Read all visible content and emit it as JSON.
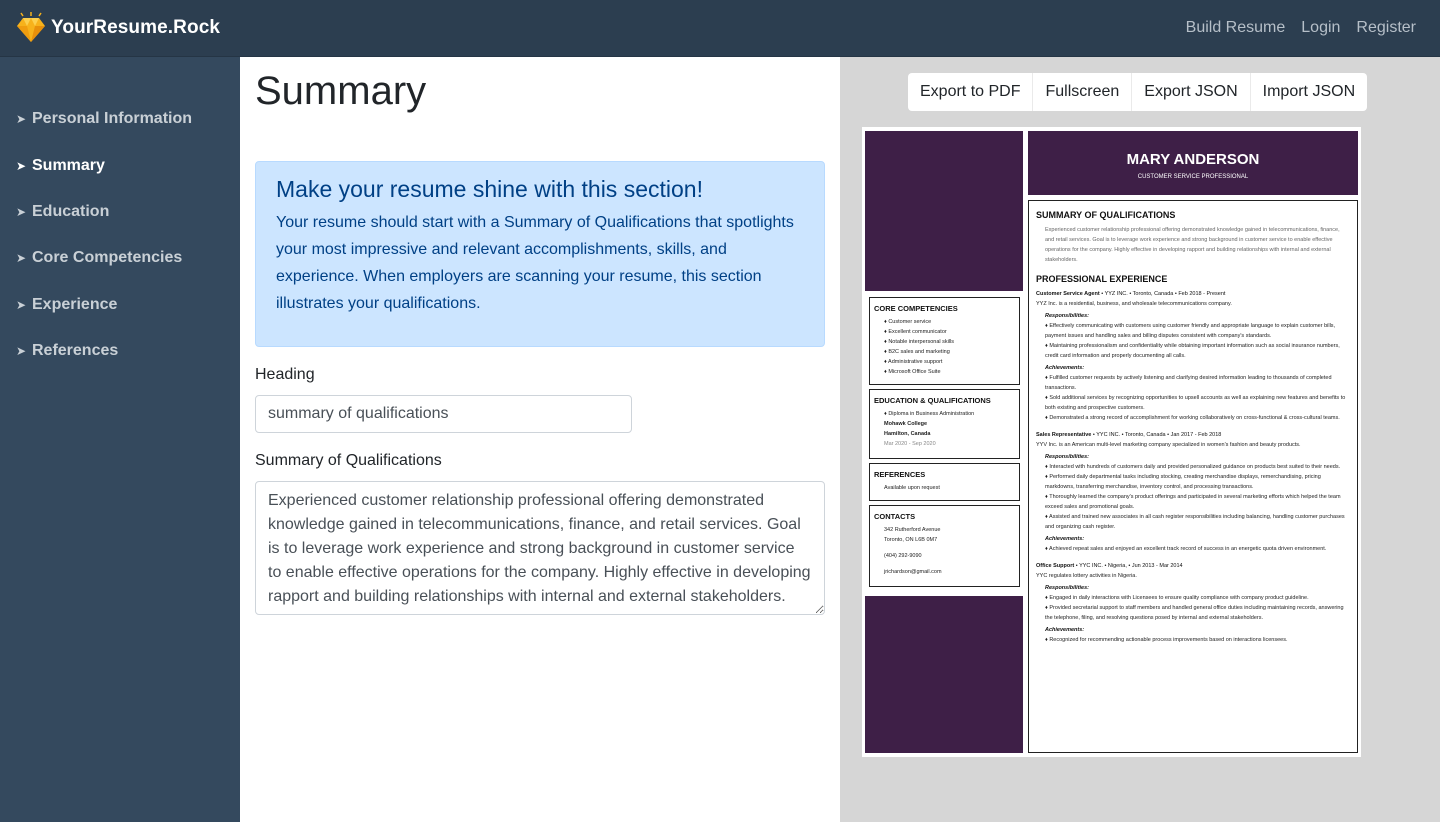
{
  "brand": {
    "name": "YourResume.Rock",
    "icon": "diamond-icon"
  },
  "nav": [
    "Build Resume",
    "Login",
    "Register"
  ],
  "sidebar": {
    "items": [
      {
        "label": "Personal Information"
      },
      {
        "label": "Summary"
      },
      {
        "label": "Education"
      },
      {
        "label": "Core Competencies"
      },
      {
        "label": "Experience"
      },
      {
        "label": "References"
      }
    ],
    "active": "Summary"
  },
  "editor": {
    "title": "Summary",
    "alert": {
      "title": "Make your resume shine with this section!",
      "text": "Your resume should start with a Summary of Qualifications that spotlights your most impressive and relevant accomplishments, skills, and experience. When employers are scanning your resume, this section illustrates your qualifications."
    },
    "heading_label": "Heading",
    "heading_value": "summary of qualifications",
    "summary_label": "Summary of Qualifications",
    "summary_value": "Experienced customer relationship professional offering demonstrated knowledge gained in telecommunications, finance, and retail services. Goal is to leverage work experience and strong background in customer service to enable effective operations for the company. Highly effective in developing rapport and building relationships with internal and external stakeholders."
  },
  "toolbar": {
    "export_pdf": "Export to PDF",
    "fullscreen": "Fullscreen",
    "export_json": "Export JSON",
    "import_json": "Import JSON"
  },
  "resume": {
    "accent_color": "#3e1f47",
    "name": "MARY ANDERSON",
    "role": "CUSTOMER SERVICE PROFESSIONAL",
    "core": {
      "title": "CORE COMPETENCIES",
      "items": [
        "♦ Customer service",
        "♦ Excellent communicator",
        "♦ Notable interpersonal skills",
        "♦ B2C sales and marketing",
        "♦ Administrative support",
        "♦ Microsoft Office Suite"
      ]
    },
    "education": {
      "title": "EDUCATION & QUALIFICATIONS",
      "degree": "♦ Diploma in Business Administration",
      "school": "Mohawk College",
      "location": "Hamilton, Canada",
      "dates": "Mar 2020 - Sep 2020"
    },
    "references": {
      "title": "REFERENCES",
      "text": "Available upon request"
    },
    "contacts": {
      "title": "CONTACTS",
      "address1": "342 Rutherford Avenue",
      "address2": "Toronto, ON L6B 0M7",
      "phone": "(404) 292-9090",
      "email": "jrichardson@gmail.com"
    },
    "summary": {
      "title": "SUMMARY OF QUALIFICATIONS",
      "text": "Experienced customer relationship professional offering demonstrated knowledge gained in telecommunications, finance, and retail services. Goal is to leverage work experience and strong background in customer service to enable effective operations for the company. Highly effective in developing rapport and building relationships with internal and external stakeholders."
    },
    "experience_title": "PROFESSIONAL EXPERIENCE",
    "responsibilities_label": "Responsibilities:",
    "achievements_label": "Achievements:",
    "jobs": [
      {
        "title": "Customer Service Agent",
        "meta": " • YYZ INC. •  Toronto, Canada • Feb 2018 - Present",
        "desc": "YYZ Inc. is a residential, business, and wholesale telecommunications company.",
        "resp": [
          "♦ Effectively communicating with customers using customer friendly and appropriate language to explain customer bills, payment issues and handling sales and billing disputes consistent with company's standards.",
          "♦ Maintaining professionalism and confidentiality while obtaining important information such as social insurance numbers, credit card information and properly documenting all calls."
        ],
        "ach": [
          "♦ Fulfilled customer requests by actively listening and clarifying desired information leading to thousands of completed transactions.",
          "♦ Sold additional services by recognizing opportunities to upsell accounts as well as explaining new features and benefits to both existing and prospective customers.",
          "♦ Demonstrated a strong record of accomplishment for working collaboratively on cross-functional & cross-cultural teams."
        ]
      },
      {
        "title": "Sales Representative",
        "meta": " • YYC INC. •  Toronto, Canada • Jan 2017 - Feb 2018",
        "desc": "YYV Inc. is an American multi-level marketing company specialized in women's fashion and beauty products.",
        "resp": [
          "♦ Interacted with hundreds of customers daily and provided personalized guidance on products best suited to their needs.",
          "♦ Performed daily departmental tasks including stocking, creating merchandise displays, remerchandising, pricing markdowns, transferring merchandise, inventory control, and processing transactions.",
          "♦ Thoroughly learned the company's product offerings and participated in several marketing efforts which helped the team exceed sales and promotional goals.",
          "♦ Assisted and trained new associates in all cash register responsibilities including balancing, handling customer purchases and organizing cash register."
        ],
        "ach": [
          "♦ Achieved repeat sales and enjoyed an excellent track record of success in an energetic quota driven environment."
        ]
      },
      {
        "title": "Office Support",
        "meta": " • YYC INC. •  Nigeria,  • Jun 2013 - Mar 2014",
        "desc": "YYC regulates lottery activities in Nigeria.",
        "resp": [
          "♦ Engaged in daily interactions with Licensees to ensure quality compliance with company product guideline.",
          "♦ Provided secretarial support to staff members and handled general office duties including maintaining records, answering the telephone, filing, and resolving questions posed by internal and external stakeholders."
        ],
        "ach": [
          "♦ Recognized for recommending actionable process improvements based on interactions licensees."
        ]
      }
    ]
  }
}
